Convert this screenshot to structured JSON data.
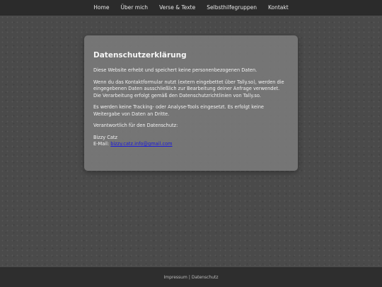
{
  "nav": {
    "items": [
      "Home",
      "Über mich",
      "Verse & Texte",
      "Selbsthilfegruppen",
      "Kontakt"
    ]
  },
  "card": {
    "title": "Datenschutzerklärung",
    "p1": "Diese Website erhebt und speichert keine personenbezogenen Daten.",
    "p2": "Wenn du das Kontaktformular nutzt (extern eingebettet über Tally.so), werden die eingegebenen Daten ausschließlich zur Bearbeitung deiner Anfrage verwendet. Die Verarbeitung erfolgt gemäß den Datenschutzrichtlinien von Tally.so.",
    "p3": "Es werden keine Tracking- oder Analyse-Tools eingesetzt. Es erfolgt keine Weitergabe von Daten an Dritte.",
    "p4": "Verantwortlich für den Datenschutz:",
    "name": "Bizzy Catz",
    "email_label": "E-Mail: ",
    "email": "bizzy.catz.info@gmail.com"
  },
  "footer": {
    "impressum": "Impressum",
    "separator": "|",
    "datenschutz": "Datenschutz"
  },
  "colors": {
    "background": "#4a4a4a",
    "nav_bar": "#2b2b2b",
    "card": "#787878",
    "link": "#1a1adc",
    "footer": "#2e2e2e"
  }
}
